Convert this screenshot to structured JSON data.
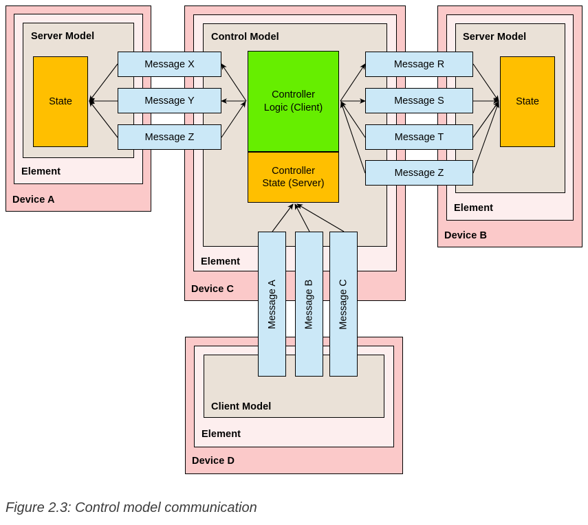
{
  "figure": {
    "caption": "Figure 2.3: Control model communication"
  },
  "colors": {
    "device_fill": "#fbc9c9",
    "element_fill": "#fdeeee",
    "model_fill": "#eae1d7",
    "state_fill": "#ffbf00",
    "logic_fill": "#66ee00",
    "message_fill": "#cbe8f7",
    "stroke": "#000000",
    "caption_text": "#3c3c3c"
  },
  "devices": {
    "a": {
      "device_label": "Device A",
      "element_label": "Element",
      "model_label": "Server Model",
      "state_label": "State"
    },
    "b": {
      "device_label": "Device B",
      "element_label": "Element",
      "model_label": "Server Model",
      "state_label": "State"
    },
    "c": {
      "device_label": "Device C",
      "element_label": "Element",
      "model_label": "Control Model",
      "logic_label_line1": "Controller",
      "logic_label_line2": "Logic (Client)",
      "state_label_line1": "Controller",
      "state_label_line2": "State (Server)"
    },
    "d": {
      "device_label": "Device D",
      "element_label": "Element",
      "model_label": "Client Model"
    }
  },
  "messages": {
    "left": [
      {
        "label": "Message X"
      },
      {
        "label": "Message Y"
      },
      {
        "label": "Message Z"
      }
    ],
    "right": [
      {
        "label": "Message R"
      },
      {
        "label": "Message S"
      },
      {
        "label": "Message T"
      },
      {
        "label": "Message Z"
      }
    ],
    "bottom": [
      {
        "label": "Message A"
      },
      {
        "label": "Message B"
      },
      {
        "label": "Message C"
      }
    ]
  }
}
